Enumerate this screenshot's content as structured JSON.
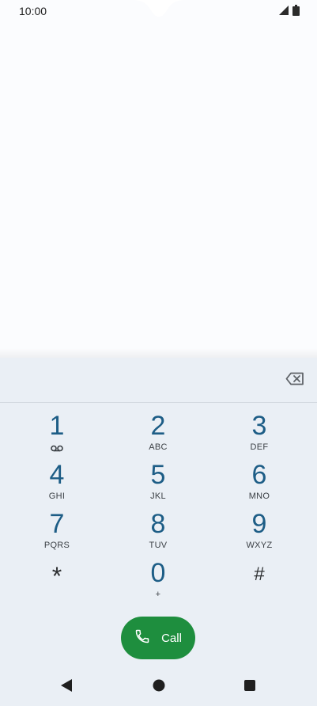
{
  "status_bar": {
    "time": "10:00"
  },
  "dialpad": {
    "number": "",
    "keys": [
      {
        "digit": "1",
        "letters": ""
      },
      {
        "digit": "2",
        "letters": "ABC"
      },
      {
        "digit": "3",
        "letters": "DEF"
      },
      {
        "digit": "4",
        "letters": "GHI"
      },
      {
        "digit": "5",
        "letters": "JKL"
      },
      {
        "digit": "6",
        "letters": "MNO"
      },
      {
        "digit": "7",
        "letters": "PQRS"
      },
      {
        "digit": "8",
        "letters": "TUV"
      },
      {
        "digit": "9",
        "letters": "WXYZ"
      },
      {
        "digit": "*",
        "letters": ""
      },
      {
        "digit": "0",
        "letters": "+"
      },
      {
        "digit": "#",
        "letters": ""
      }
    ],
    "call_label": "Call"
  },
  "icons": {
    "voicemail": "voicemail-icon",
    "backspace": "backspace-icon",
    "call": "phone-icon",
    "signal": "signal-icon",
    "battery": "battery-icon",
    "nav_back": "back-icon",
    "nav_home": "home-icon",
    "nav_recents": "recents-icon"
  },
  "colors": {
    "digit": "#1d5d86",
    "call_button": "#1e8e3e",
    "dialpad_bg": "#eaeff5"
  }
}
